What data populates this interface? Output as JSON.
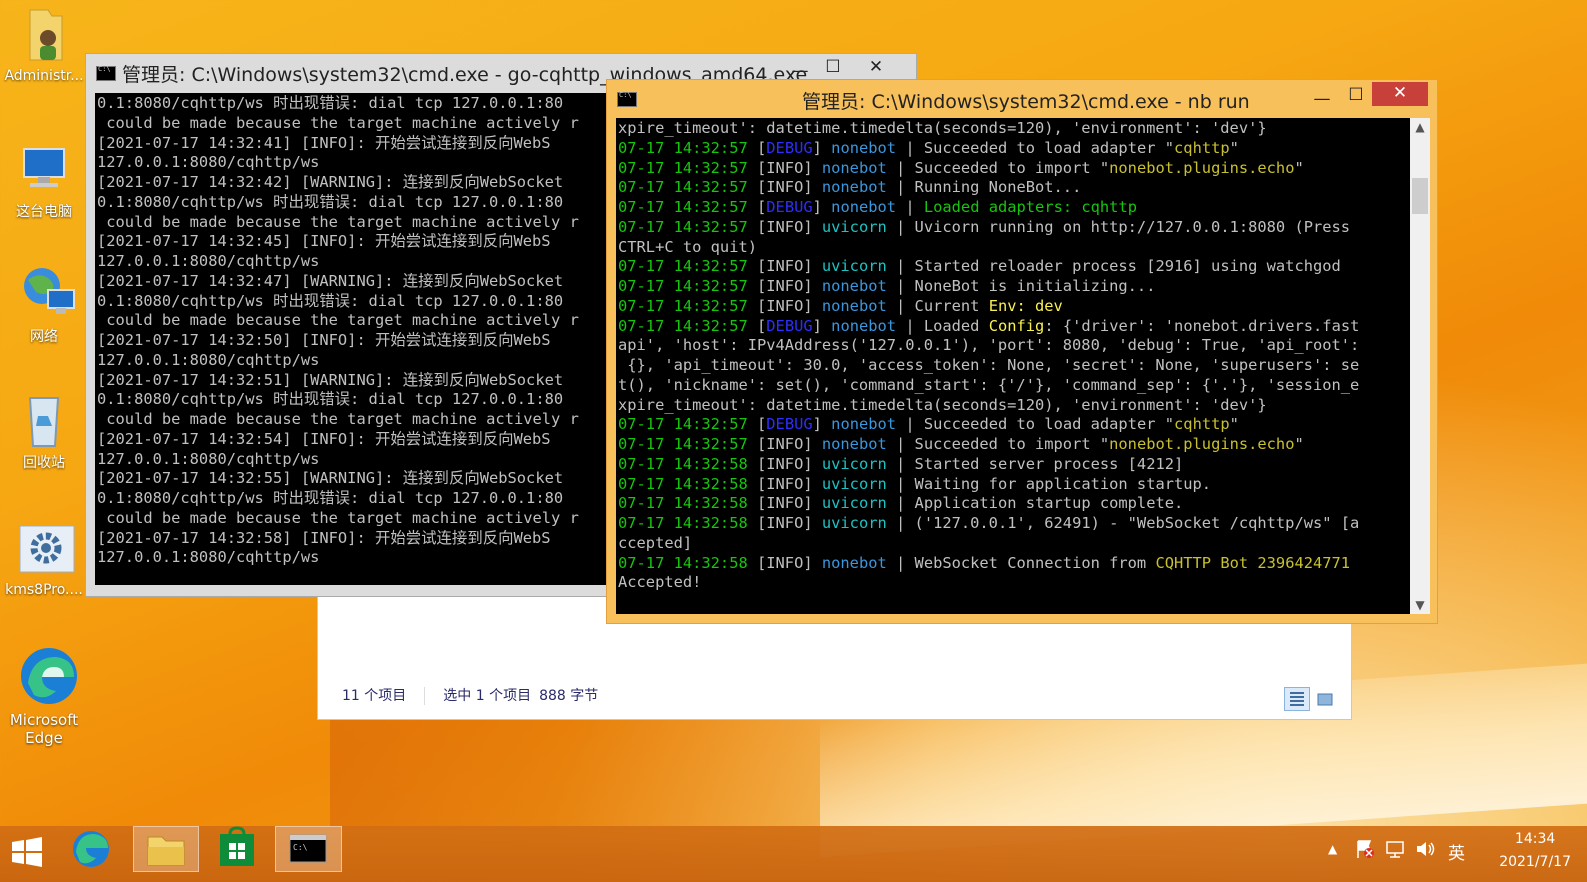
{
  "desktop": {
    "icons": [
      {
        "label": "Administr..."
      },
      {
        "label": "这台电脑"
      },
      {
        "label": "网络"
      },
      {
        "label": "回收站"
      },
      {
        "label": "kms8Pro...."
      },
      {
        "label": "Microsoft Edge",
        "line1": "Microsoft",
        "line2": "Edge"
      }
    ]
  },
  "explorer": {
    "status_items": "11 个项目",
    "status_selected": "选中 1 个项目",
    "status_size": "888 字节"
  },
  "cmd_back": {
    "title": "管理员: C:\\Windows\\system32\\cmd.exe - go-cqhttp_windows_amd64.exe",
    "lines": [
      "0.1:8080/cqhttp/ws 时出现错误: dial tcp 127.0.0.1:80",
      " could be made because the target machine actively r",
      "[2021-07-17 14:32:41] [INFO]: 开始尝试连接到反向WebS",
      "127.0.0.1:8080/cqhttp/ws",
      "[2021-07-17 14:32:42] [WARNING]: 连接到反向WebSocket",
      "0.1:8080/cqhttp/ws 时出现错误: dial tcp 127.0.0.1:80",
      " could be made because the target machine actively r",
      "[2021-07-17 14:32:45] [INFO]: 开始尝试连接到反向WebS",
      "127.0.0.1:8080/cqhttp/ws",
      "[2021-07-17 14:32:47] [WARNING]: 连接到反向WebSocket",
      "0.1:8080/cqhttp/ws 时出现错误: dial tcp 127.0.0.1:80",
      " could be made because the target machine actively r",
      "[2021-07-17 14:32:50] [INFO]: 开始尝试连接到反向WebS",
      "127.0.0.1:8080/cqhttp/ws",
      "[2021-07-17 14:32:51] [WARNING]: 连接到反向WebSocket",
      "0.1:8080/cqhttp/ws 时出现错误: dial tcp 127.0.0.1:80",
      " could be made because the target machine actively r",
      "[2021-07-17 14:32:54] [INFO]: 开始尝试连接到反向WebS",
      "127.0.0.1:8080/cqhttp/ws",
      "[2021-07-17 14:32:55] [WARNING]: 连接到反向WebSocket",
      "0.1:8080/cqhttp/ws 时出现错误: dial tcp 127.0.0.1:80",
      " could be made because the target machine actively r",
      "[2021-07-17 14:32:58] [INFO]: 开始尝试连接到反向WebS",
      "127.0.0.1:8080/cqhttp/ws"
    ]
  },
  "cmd_front": {
    "title": "管理员: C:\\Windows\\system32\\cmd.exe - nb  run",
    "lines": [
      [
        {
          "t": "xpire_timeout': datetime.timedelta(seconds=120), 'environment': 'dev'}"
        }
      ],
      [
        {
          "t": "07-17 14:32:57 ",
          "c": "time"
        },
        {
          "t": "["
        },
        {
          "t": "DEBUG",
          "c": "debug"
        },
        {
          "t": "] "
        },
        {
          "t": "nonebot",
          "c": "nb"
        },
        {
          "t": " | Succeeded to load adapter \""
        },
        {
          "t": "cqhttp",
          "c": "ylw"
        },
        {
          "t": "\""
        }
      ],
      [
        {
          "t": "07-17 14:32:57 ",
          "c": "time"
        },
        {
          "t": "[INFO] "
        },
        {
          "t": "nonebot",
          "c": "nb"
        },
        {
          "t": " | Succeeded to import \""
        },
        {
          "t": "nonebot.plugins.echo",
          "c": "ylw"
        },
        {
          "t": "\""
        }
      ],
      [
        {
          "t": "07-17 14:32:57 ",
          "c": "time"
        },
        {
          "t": "[INFO] "
        },
        {
          "t": "nonebot",
          "c": "nb"
        },
        {
          "t": " | Running NoneBot..."
        }
      ],
      [
        {
          "t": "07-17 14:32:57 ",
          "c": "time"
        },
        {
          "t": "["
        },
        {
          "t": "DEBUG",
          "c": "debug"
        },
        {
          "t": "] "
        },
        {
          "t": "nonebot",
          "c": "nb"
        },
        {
          "t": " | "
        },
        {
          "t": "Loaded adapters: cqhttp",
          "c": "time"
        }
      ],
      [
        {
          "t": "07-17 14:32:57 ",
          "c": "time"
        },
        {
          "t": "[INFO] "
        },
        {
          "t": "uvicorn",
          "c": "uv"
        },
        {
          "t": " | Uvicorn running on http://127.0.0.1:8080 (Press"
        }
      ],
      [
        {
          "t": "CTRL+C to quit)"
        }
      ],
      [
        {
          "t": "07-17 14:32:57 ",
          "c": "time"
        },
        {
          "t": "[INFO] "
        },
        {
          "t": "uvicorn",
          "c": "uv"
        },
        {
          "t": " | Started reloader process [2916] using watchgod"
        }
      ],
      [
        {
          "t": "07-17 14:32:57 ",
          "c": "time"
        },
        {
          "t": "[INFO] "
        },
        {
          "t": "nonebot",
          "c": "nb"
        },
        {
          "t": " | NoneBot is initializing..."
        }
      ],
      [
        {
          "t": "07-17 14:32:57 ",
          "c": "time"
        },
        {
          "t": "[INFO] "
        },
        {
          "t": "nonebot",
          "c": "nb"
        },
        {
          "t": " | Current "
        },
        {
          "t": "Env: dev",
          "c": "hl"
        }
      ],
      [
        {
          "t": "07-17 14:32:57 ",
          "c": "time"
        },
        {
          "t": "["
        },
        {
          "t": "DEBUG",
          "c": "debug"
        },
        {
          "t": "] "
        },
        {
          "t": "nonebot",
          "c": "nb"
        },
        {
          "t": " | Loaded "
        },
        {
          "t": "Config",
          "c": "hl"
        },
        {
          "t": ": {'driver': 'nonebot.drivers.fast"
        }
      ],
      [
        {
          "t": "api', 'host': IPv4Address('127.0.0.1'), 'port': 8080, 'debug': True, 'api_root':"
        }
      ],
      [
        {
          "t": " {}, 'api_timeout': 30.0, 'access_token': None, 'secret': None, 'superusers': se"
        }
      ],
      [
        {
          "t": "t(), 'nickname': set(), 'command_start': {'/'}, 'command_sep': {'.'}, 'session_e"
        }
      ],
      [
        {
          "t": "xpire_timeout': datetime.timedelta(seconds=120), 'environment': 'dev'}"
        }
      ],
      [
        {
          "t": "07-17 14:32:57 ",
          "c": "time"
        },
        {
          "t": "["
        },
        {
          "t": "DEBUG",
          "c": "debug"
        },
        {
          "t": "] "
        },
        {
          "t": "nonebot",
          "c": "nb"
        },
        {
          "t": " | Succeeded to load adapter \""
        },
        {
          "t": "cqhttp",
          "c": "ylw"
        },
        {
          "t": "\""
        }
      ],
      [
        {
          "t": "07-17 14:32:57 ",
          "c": "time"
        },
        {
          "t": "[INFO] "
        },
        {
          "t": "nonebot",
          "c": "nb"
        },
        {
          "t": " | Succeeded to import \""
        },
        {
          "t": "nonebot.plugins.echo",
          "c": "ylw"
        },
        {
          "t": "\""
        }
      ],
      [
        {
          "t": "07-17 14:32:58 ",
          "c": "time"
        },
        {
          "t": "[INFO] "
        },
        {
          "t": "uvicorn",
          "c": "uv"
        },
        {
          "t": " | Started server process [4212]"
        }
      ],
      [
        {
          "t": "07-17 14:32:58 ",
          "c": "time"
        },
        {
          "t": "[INFO] "
        },
        {
          "t": "uvicorn",
          "c": "uv"
        },
        {
          "t": " | Waiting for application startup."
        }
      ],
      [
        {
          "t": "07-17 14:32:58 ",
          "c": "time"
        },
        {
          "t": "[INFO] "
        },
        {
          "t": "uvicorn",
          "c": "uv"
        },
        {
          "t": " | Application startup complete."
        }
      ],
      [
        {
          "t": "07-17 14:32:58 ",
          "c": "time"
        },
        {
          "t": "[INFO] "
        },
        {
          "t": "uvicorn",
          "c": "uv"
        },
        {
          "t": " | ('127.0.0.1', 62491) - \"WebSocket /cqhttp/ws\" [a"
        }
      ],
      [
        {
          "t": "ccepted]"
        }
      ],
      [
        {
          "t": "07-17 14:32:58 ",
          "c": "time"
        },
        {
          "t": "[INFO] "
        },
        {
          "t": "nonebot",
          "c": "nb"
        },
        {
          "t": " | WebSocket Connection from "
        },
        {
          "t": "CQHTTP Bot 2396424771",
          "c": "ylw"
        }
      ],
      [
        {
          "t": "Accepted!"
        }
      ]
    ]
  },
  "window_controls": {
    "minimize": "—",
    "maximize": "☐",
    "close": "✕"
  },
  "taskbar": {
    "tray_ime": "英",
    "clock_time": "14:34",
    "clock_date": "2021/7/17"
  },
  "colors": {
    "accent": "#f6a712",
    "close_button": "#c7413a",
    "console_bg": "#000000",
    "log_time": "#16c60c",
    "log_debug": "#2e2efb",
    "log_nonebot": "#3a96dd",
    "log_uvicorn": "#1ec2c2"
  }
}
